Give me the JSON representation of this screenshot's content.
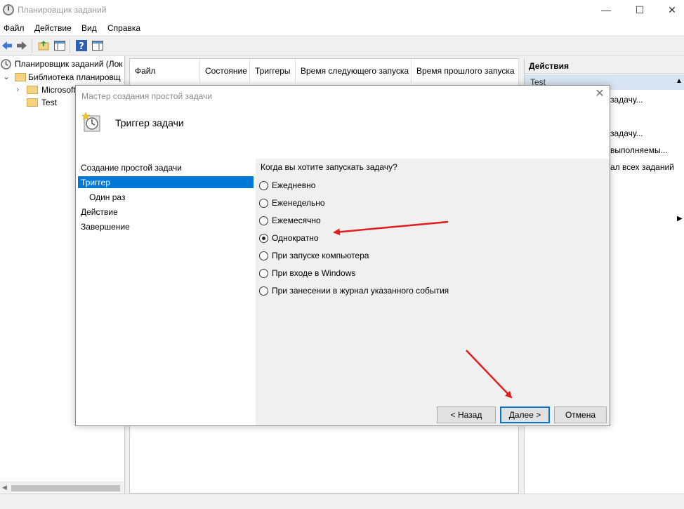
{
  "window": {
    "title": "Планировщик заданий",
    "minimize": "—",
    "maximize": "☐",
    "close": "✕"
  },
  "menu": [
    "Файл",
    "Действие",
    "Вид",
    "Справка"
  ],
  "tree": {
    "root": "Планировщик заданий (Лок",
    "library": "Библиотека планировщ",
    "microsoft": "Microsoft",
    "test": "Test"
  },
  "list_columns": [
    "Файл",
    "Состояние",
    "Триггеры",
    "Время следующего запуска",
    "Время прошлого запуска"
  ],
  "actions": {
    "header": "Действия",
    "subheader": "Test",
    "items": [
      "задачу...",
      "задачу...",
      "выполняемы...",
      "ал всех заданий"
    ]
  },
  "dialog": {
    "title": "Мастер создания простой задачи",
    "heading": "Триггер задачи",
    "close": "✕",
    "steps": [
      "Создание простой задачи",
      "Триггер",
      "Один раз",
      "Действие",
      "Завершение"
    ],
    "question": "Когда вы хотите запускать задачу?",
    "options": [
      "Ежедневно",
      "Еженедельно",
      "Ежемесячно",
      "Однократно",
      "При запуске компьютера",
      "При входе в Windows",
      "При занесении в журнал указанного события"
    ],
    "selected_option": "Однократно",
    "buttons": {
      "back": "< Назад",
      "next": "Далее >",
      "cancel": "Отмена"
    }
  },
  "colors": {
    "selection": "#0078d7",
    "annotation_arrow": "#e02020"
  }
}
